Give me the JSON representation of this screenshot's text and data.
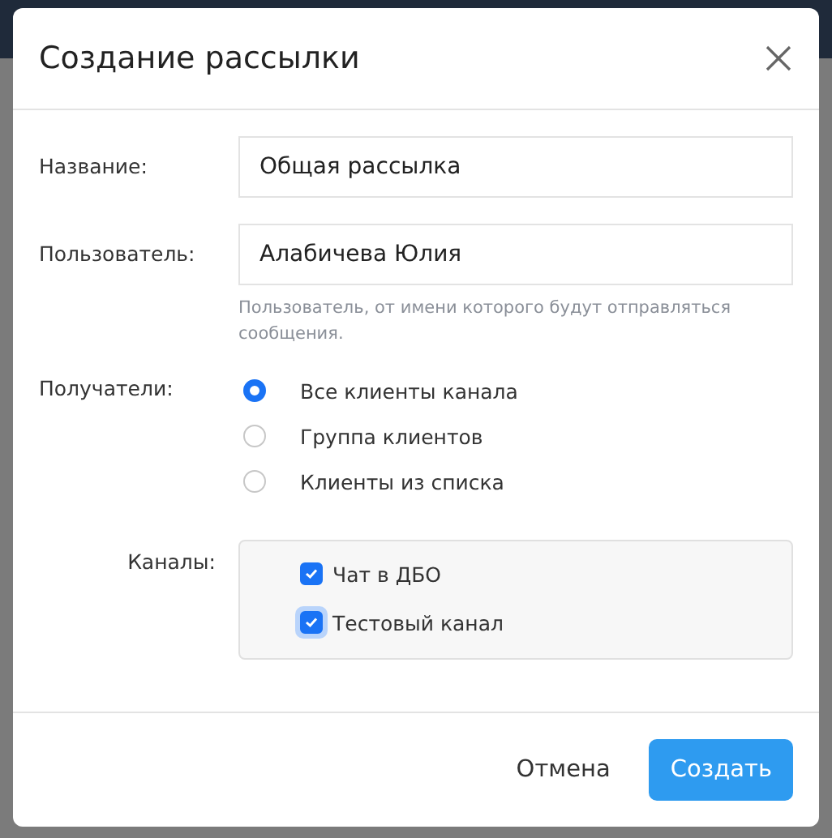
{
  "dialog": {
    "title": "Создание рассылки"
  },
  "fields": [
    {
      "label": "Название:",
      "value": "Общая рассылка"
    },
    {
      "label": "Пользователь:",
      "value": "Алабичева Юлия",
      "hint": "Пользователь, от имени которого будут отправляться сообщения."
    }
  ],
  "recipients": {
    "label": "Получатели:",
    "options": [
      {
        "label": "Все клиенты канала",
        "selected": true
      },
      {
        "label": "Группа клиентов",
        "selected": false
      },
      {
        "label": "Клиенты из списка",
        "selected": false
      }
    ]
  },
  "channels": {
    "label": "Каналы:",
    "items": [
      {
        "label": "Чат в ДБО",
        "checked": true,
        "focused": false
      },
      {
        "label": "Тестовый канал",
        "checked": true,
        "focused": true
      }
    ]
  },
  "buttons": [
    {
      "label": "Отмена",
      "kind": "secondary"
    },
    {
      "label": "Создать",
      "kind": "primary"
    }
  ]
}
